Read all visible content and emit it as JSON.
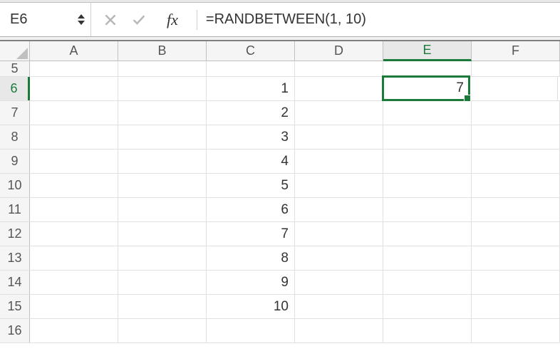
{
  "name_box": "E6",
  "formula": "=RANDBETWEEN(1, 10)",
  "fx_label": "fx",
  "columns": [
    "A",
    "B",
    "C",
    "D",
    "E",
    "F"
  ],
  "active_column_index": 4,
  "rows": [
    {
      "num": "5",
      "cells": [
        "",
        "",
        "",
        "",
        "",
        ""
      ],
      "active": false
    },
    {
      "num": "6",
      "cells": [
        "",
        "",
        "1",
        "",
        "7",
        ""
      ],
      "active": true
    },
    {
      "num": "7",
      "cells": [
        "",
        "",
        "2",
        "",
        "",
        ""
      ],
      "active": false
    },
    {
      "num": "8",
      "cells": [
        "",
        "",
        "3",
        "",
        "",
        ""
      ],
      "active": false
    },
    {
      "num": "9",
      "cells": [
        "",
        "",
        "4",
        "",
        "",
        ""
      ],
      "active": false
    },
    {
      "num": "10",
      "cells": [
        "",
        "",
        "5",
        "",
        "",
        ""
      ],
      "active": false
    },
    {
      "num": "11",
      "cells": [
        "",
        "",
        "6",
        "",
        "",
        ""
      ],
      "active": false
    },
    {
      "num": "12",
      "cells": [
        "",
        "",
        "7",
        "",
        "",
        ""
      ],
      "active": false
    },
    {
      "num": "13",
      "cells": [
        "",
        "",
        "8",
        "",
        "",
        ""
      ],
      "active": false
    },
    {
      "num": "14",
      "cells": [
        "",
        "",
        "9",
        "",
        "",
        ""
      ],
      "active": false
    },
    {
      "num": "15",
      "cells": [
        "",
        "",
        "10",
        "",
        "",
        ""
      ],
      "active": false
    },
    {
      "num": "16",
      "cells": [
        "",
        "",
        "",
        "",
        "",
        ""
      ],
      "active": false
    }
  ],
  "selected_cell": {
    "row": 1,
    "col": 4
  }
}
